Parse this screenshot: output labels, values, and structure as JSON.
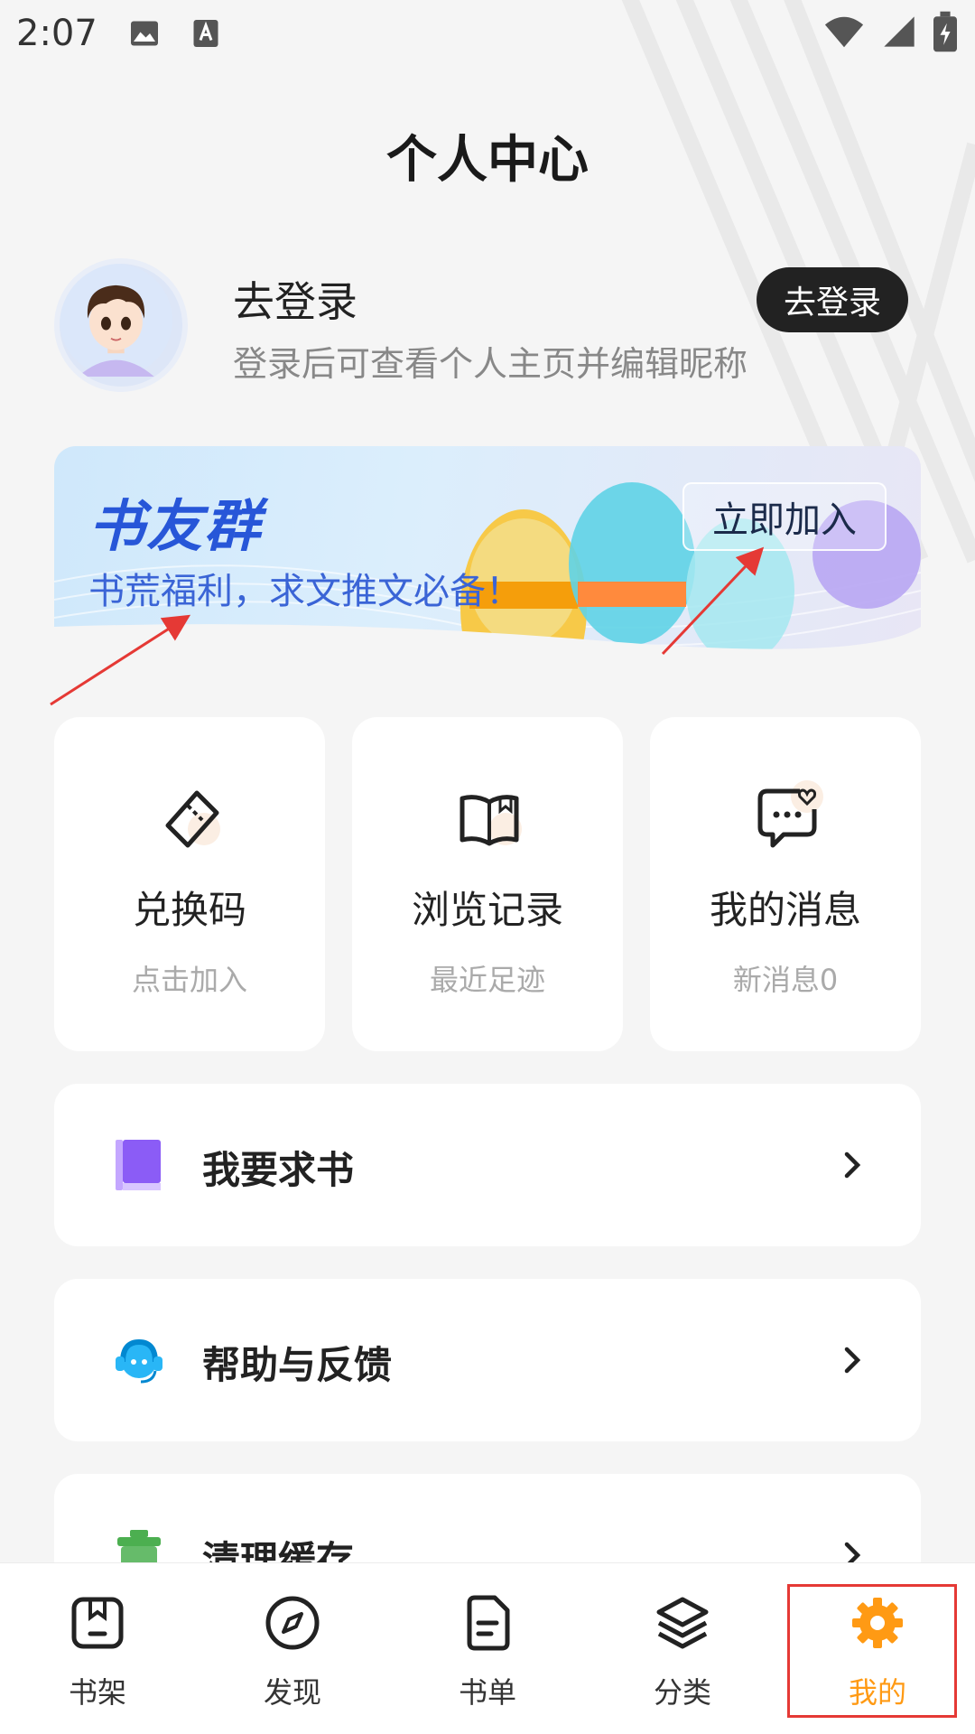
{
  "status_bar": {
    "time": "2:07"
  },
  "header": {
    "title": "个人中心"
  },
  "profile": {
    "name": "去登录",
    "subtitle": "登录后可查看个人主页并编辑昵称",
    "login_button": "去登录"
  },
  "banner": {
    "title": "书友群",
    "subtitle": "书荒福利，求文推文必备！",
    "join_button": "立即加入"
  },
  "features": [
    {
      "title": "兑换码",
      "subtitle": "点击加入",
      "icon": "ticket-icon"
    },
    {
      "title": "浏览记录",
      "subtitle": "最近足迹",
      "icon": "book-open-icon"
    },
    {
      "title": "我的消息",
      "subtitle": "新消息0",
      "icon": "message-heart-icon"
    }
  ],
  "menu": [
    {
      "label": "我要求书",
      "icon": "book-request-icon",
      "color": "#8b5cf6"
    },
    {
      "label": "帮助与反馈",
      "icon": "headset-icon",
      "color": "#29b6f6"
    },
    {
      "label": "清理缓存",
      "icon": "trash-icon",
      "color": "#4caf50"
    }
  ],
  "bottom_nav": [
    {
      "label": "书架",
      "icon": "bookshelf-icon"
    },
    {
      "label": "发现",
      "icon": "compass-icon"
    },
    {
      "label": "书单",
      "icon": "document-icon"
    },
    {
      "label": "分类",
      "icon": "layers-icon"
    },
    {
      "label": "我的",
      "icon": "gear-icon",
      "active": true
    }
  ],
  "colors": {
    "accent": "#ff9a14",
    "banner_blue": "#2756d8",
    "annotation_red": "#e53935"
  }
}
